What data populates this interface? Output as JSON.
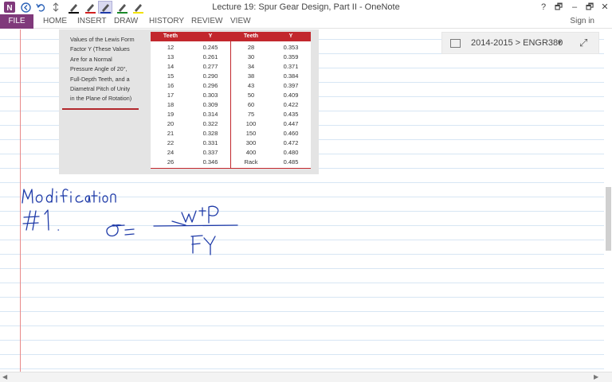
{
  "window": {
    "title": "Lecture 19: Spur Gear Design, Part II - OneNote",
    "controls": [
      "?",
      "🗗",
      "–",
      "🗗",
      "✕"
    ]
  },
  "ribbon": {
    "file": "FILE",
    "tabs": [
      "HOME",
      "INSERT",
      "DRAW",
      "HISTORY",
      "REVIEW",
      "VIEW"
    ],
    "sign_in": "Sign in"
  },
  "notebook": {
    "breadcrumb": "2014-2015 > ENGR380",
    "caret": "▾",
    "expand": "⤢"
  },
  "table": {
    "caption": [
      "Values of the Lewis Form",
      "Factor Y (These Values",
      "Are for a Normal",
      "Pressure Angle of 20°,",
      "Full-Depth Teeth, and a",
      "Diametral Pitch of Unity",
      "in the Plane of Rotation)"
    ],
    "headers": [
      "Teeth",
      "Y",
      "Teeth",
      "Y"
    ],
    "rows": [
      [
        "12",
        "0.245",
        "28",
        "0.353"
      ],
      [
        "13",
        "0.261",
        "30",
        "0.359"
      ],
      [
        "14",
        "0.277",
        "34",
        "0.371"
      ],
      [
        "15",
        "0.290",
        "38",
        "0.384"
      ],
      [
        "16",
        "0.296",
        "43",
        "0.397"
      ],
      [
        "17",
        "0.303",
        "50",
        "0.409"
      ],
      [
        "18",
        "0.309",
        "60",
        "0.422"
      ],
      [
        "19",
        "0.314",
        "75",
        "0.435"
      ],
      [
        "20",
        "0.322",
        "100",
        "0.447"
      ],
      [
        "21",
        "0.328",
        "150",
        "0.460"
      ],
      [
        "22",
        "0.331",
        "300",
        "0.472"
      ],
      [
        "24",
        "0.337",
        "400",
        "0.480"
      ],
      [
        "26",
        "0.346",
        "Rack",
        "0.485"
      ]
    ]
  },
  "handwriting": {
    "heading": "Modification",
    "number": "#1.",
    "equation": "σ = WᵗP / FY"
  },
  "colors": {
    "file_tab": "#80397b",
    "table_header": "#c2272d",
    "ink": "#1e3aa8",
    "margin": "#e88a8a",
    "rule_lines": "#d7e6f4"
  },
  "icons": [
    "onenote-logo-icon",
    "back-icon",
    "undo-icon",
    "dock-icon",
    "pen-black-icon",
    "pen-red-icon",
    "pen-blue-icon",
    "pen-green-icon",
    "highlighter-yellow-icon"
  ]
}
